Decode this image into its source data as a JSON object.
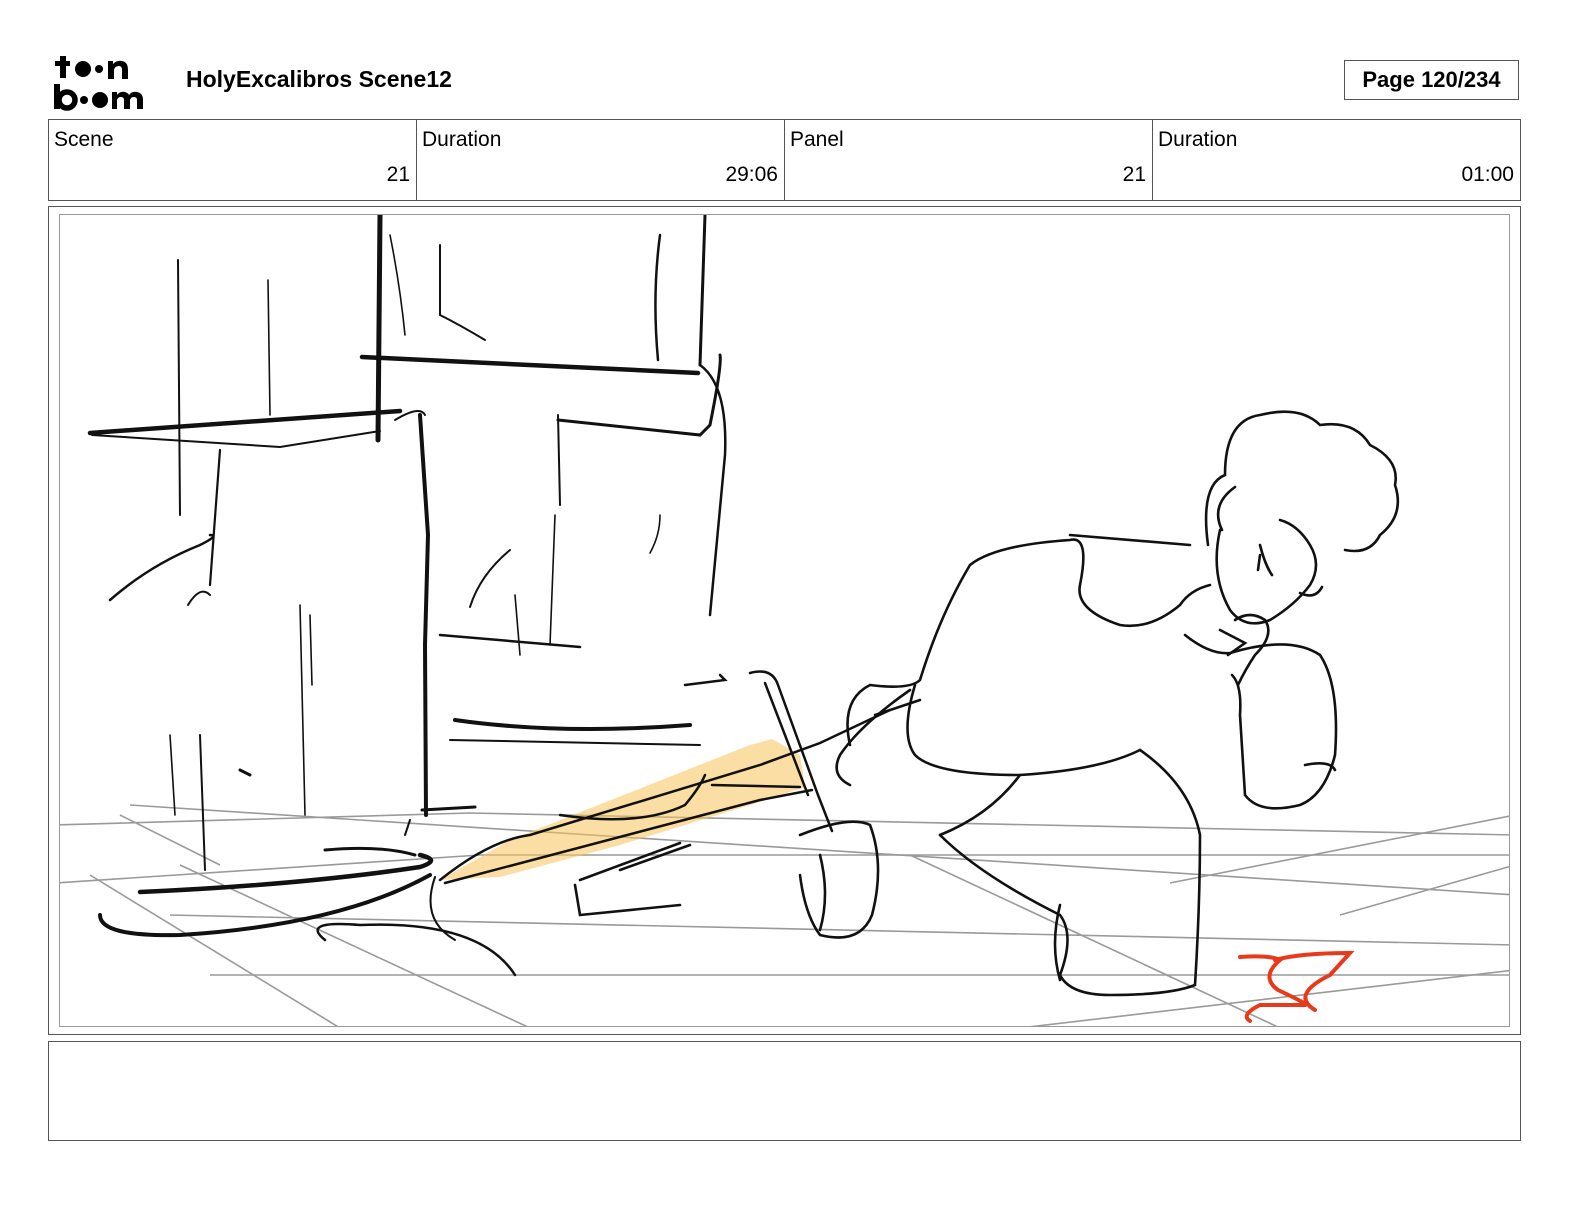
{
  "header": {
    "logo_top": "t●●n",
    "logo_bottom": "b●●m",
    "project_title": "HolyExcalibros Scene12",
    "page": "Page 120/234"
  },
  "info": {
    "scene_label": "Scene",
    "scene_value": "21",
    "scene_duration_label": "Duration",
    "scene_duration_value": "29:06",
    "panel_label": "Panel",
    "panel_value": "21",
    "panel_duration_label": "Duration",
    "panel_duration_value": "01:00"
  },
  "panel": {
    "colors": {
      "sketch": "#111111",
      "floor": "#9a9a9a",
      "sword_glow": "#f7c25a",
      "red_mark": "#e8391b"
    }
  },
  "notes": {
    "text": ""
  }
}
